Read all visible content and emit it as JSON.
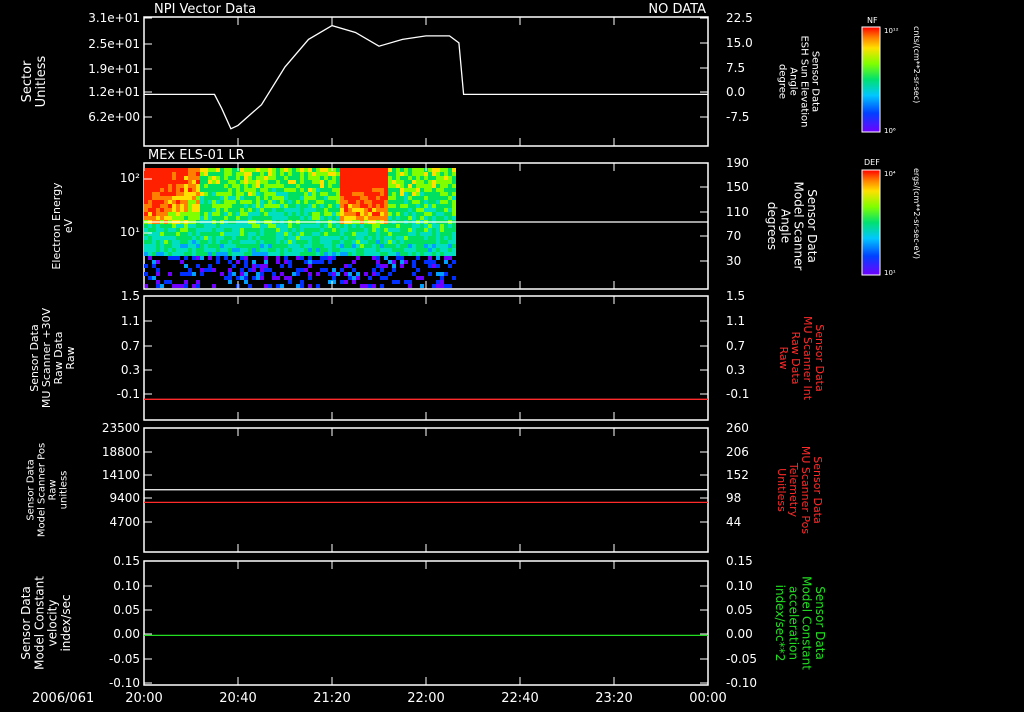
{
  "colors": {
    "background": "#000000",
    "axis": "#ffffff",
    "red": "#ff2a2a",
    "green": "#22dd22"
  },
  "time_axis": {
    "date_label": "2006/061",
    "ticks": [
      "20:00",
      "20:40",
      "21:20",
      "22:00",
      "22:40",
      "23:20",
      "00:00"
    ],
    "start": "20:00",
    "end": "24:00"
  },
  "panels": [
    {
      "title_left": "NPI Vector Data",
      "title_right": "NO DATA"
    },
    {
      "title_left": "MEx ELS-01 LR"
    },
    {},
    {},
    {}
  ],
  "colorbars": [
    {
      "label": "NF",
      "top_tick": "10¹²",
      "bottom_tick": "10⁶",
      "side_label": "cnts/(cm**2-sr-sec)"
    },
    {
      "label": "DEF",
      "top_tick": "10⁴",
      "bottom_tick": "10¹",
      "side_label": "ergs/(cm**2-sr-sec-eV)"
    }
  ],
  "chart_data": [
    {
      "type": "line",
      "left_axis": {
        "label_lines": [
          "Sector",
          "Unitless"
        ],
        "ticks": [
          "3.1e+01",
          "2.5e+01",
          "1.9e+01",
          "1.2e+01",
          "6.2e+00"
        ]
      },
      "right_axis": {
        "label_lines": [
          "Sensor Data",
          "ESH Sun Elevation",
          "Angle",
          "degree"
        ],
        "ticks": [
          "22.5",
          "15.0",
          "7.5",
          "0.0",
          "-7.5"
        ],
        "ylim": [
          -15,
          22.5
        ]
      },
      "series": [
        {
          "x": [
            "20:00",
            "20:30",
            "20:33",
            "20:37",
            "20:40",
            "20:50",
            "21:00",
            "21:10",
            "21:20",
            "21:30",
            "21:40",
            "21:50",
            "22:00",
            "22:10",
            "22:14",
            "22:16",
            "24:00"
          ],
          "y": [
            0,
            0,
            -4,
            -10,
            -9,
            -3,
            8,
            16,
            20,
            18,
            14,
            16,
            17,
            17,
            15,
            0,
            0
          ]
        }
      ]
    },
    {
      "type": "heatmap",
      "left_axis": {
        "label_lines": [
          "Electron Energy",
          "eV"
        ],
        "ticks": [
          "10²",
          "10¹"
        ]
      },
      "right_axis": {
        "label_lines": [
          "Sensor Data",
          "Model Scanner",
          "Angle",
          "degrees"
        ],
        "ticks": [
          "190",
          "150",
          "110",
          "70",
          "30"
        ],
        "ylim": [
          0,
          190
        ]
      },
      "data_extent": {
        "x": [
          "20:00",
          "22:12"
        ]
      },
      "line": {
        "y": 101
      }
    },
    {
      "type": "line",
      "left_axis": {
        "label_lines": [
          "Sensor Data",
          "MU Scanner +30V",
          "Raw Data",
          "Raw"
        ],
        "ticks": [
          "1.5",
          "1.1",
          "0.7",
          "0.3",
          "-0.1"
        ],
        "ylim": [
          -0.3,
          1.5
        ]
      },
      "right_axis": {
        "label_lines": [
          "Sensor Data",
          "MU Scanner Int",
          "Raw Data",
          "Raw"
        ],
        "ticks": [
          "1.5",
          "1.1",
          "0.7",
          "0.3",
          "-0.1"
        ]
      },
      "series": [
        {
          "value": 0.0
        }
      ]
    },
    {
      "type": "line",
      "left_axis": {
        "label_lines": [
          "Sensor Data",
          "Model Scanner Pos",
          "Raw",
          "unitless"
        ],
        "ticks": [
          "23500",
          "18800",
          "14100",
          "9400",
          "4700"
        ],
        "ylim": [
          0,
          23500
        ]
      },
      "right_axis": {
        "label_lines": [
          "Sensor Data",
          "MU Scanner Pos",
          "Telemetry",
          "Unitless"
        ],
        "ticks": [
          "260",
          "206",
          "152",
          "98",
          "44"
        ],
        "ylim": [
          -10,
          260
        ]
      },
      "series": [
        {
          "value": 11800
        },
        {
          "value": 98
        }
      ]
    },
    {
      "type": "line",
      "left_axis": {
        "label_lines": [
          "Sensor Data",
          "Model Constant",
          "velocity",
          "index/sec"
        ],
        "ticks": [
          "0.15",
          "0.10",
          "0.05",
          "0.00",
          "-0.05",
          "-0.10"
        ],
        "ylim": [
          -0.1,
          0.15
        ]
      },
      "right_axis": {
        "label_lines": [
          "Sensor Data",
          "Model Constant",
          "acceleration",
          "index/sec**2"
        ],
        "ticks": [
          "0.15",
          "0.10",
          "0.05",
          "0.00",
          "-0.05",
          "-0.10"
        ]
      },
      "series": [
        {
          "value": 0.0
        }
      ]
    }
  ]
}
